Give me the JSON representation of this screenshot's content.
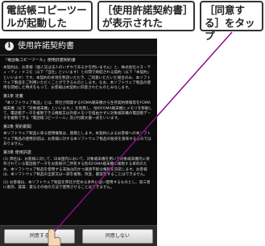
{
  "callouts": {
    "step1": "電話帳コピーツールが起動した",
    "step2": "［使用許諾契約書］が表示された",
    "step3": "［同意する］をタップ"
  },
  "dialog": {
    "title": "使用許諾契約書",
    "doc_title": "「電話帳コピーツール」使用許諾契約書",
    "paragraphs": [
      "本契約は、お客様（個人又は法人のいずれであるかを問いません）と、株式会社エヌ・ティ・ティ・ドコモ（以下「当社」といいます）との間で締結される契約（以下「本契約」といいます）です。本契約の条項を熟読いただき、ご同意いただいた場合のみ、本ソフトウェア製品をご利用いただくことができるものとします。なお、本ソフトウェア製品の使用を開始した時点をもって、お客様は本契約に同意されたものとみなします。",
      "第1条 定義",
      "「本ソフトウェア製品」とは、弊社が開発するFOMA端末機から生存契約情報等をFOMA端末機（以下「対象端末機」といいます。）を利用し、他のFOMA端末機とメモリを移動して、電話帳データを複製できる機能又は外部メモリを経由せずに対象端末機の電話帳データを複製できる「電話帳コピーツール」及び付属文書一式をいいます。",
      "第2条 契約期間",
      "本ソフトウェア製品に係る使用権限は、無償とします。本契約によるお客様への本ソフトウェア製品の使用許諾は、お客様に対する本ソフトウェア製品の販売を意味するものではありません。",
      "第3条 使用許諾",
      "(1) 弊社は、お客様に対して、日本国内において、対象端末機を用いて対象端末機内に保存されている電話帳データをお客様がご所有する別のFOMA端末機に複製する目的のため、本ソフトウェア製品を使用する非独占的かつ譲渡不能な権利を許諾します。お客様は、本ソフトウェア製品の全部又は一部を複製、改変、翻案等することはできません。",
      "(2) お客様は、本ソフトウェア製品を弊社が定める条件に従い使用するものとし、第三者に販売、賃貸、貸与その他の方法で使用させることはできません。"
    ]
  },
  "buttons": {
    "agree": "同意する",
    "disagree": "同意しない"
  },
  "colors": {
    "pointer_line": "#8b0a8b",
    "screen_bg": "#0b0b0b"
  }
}
